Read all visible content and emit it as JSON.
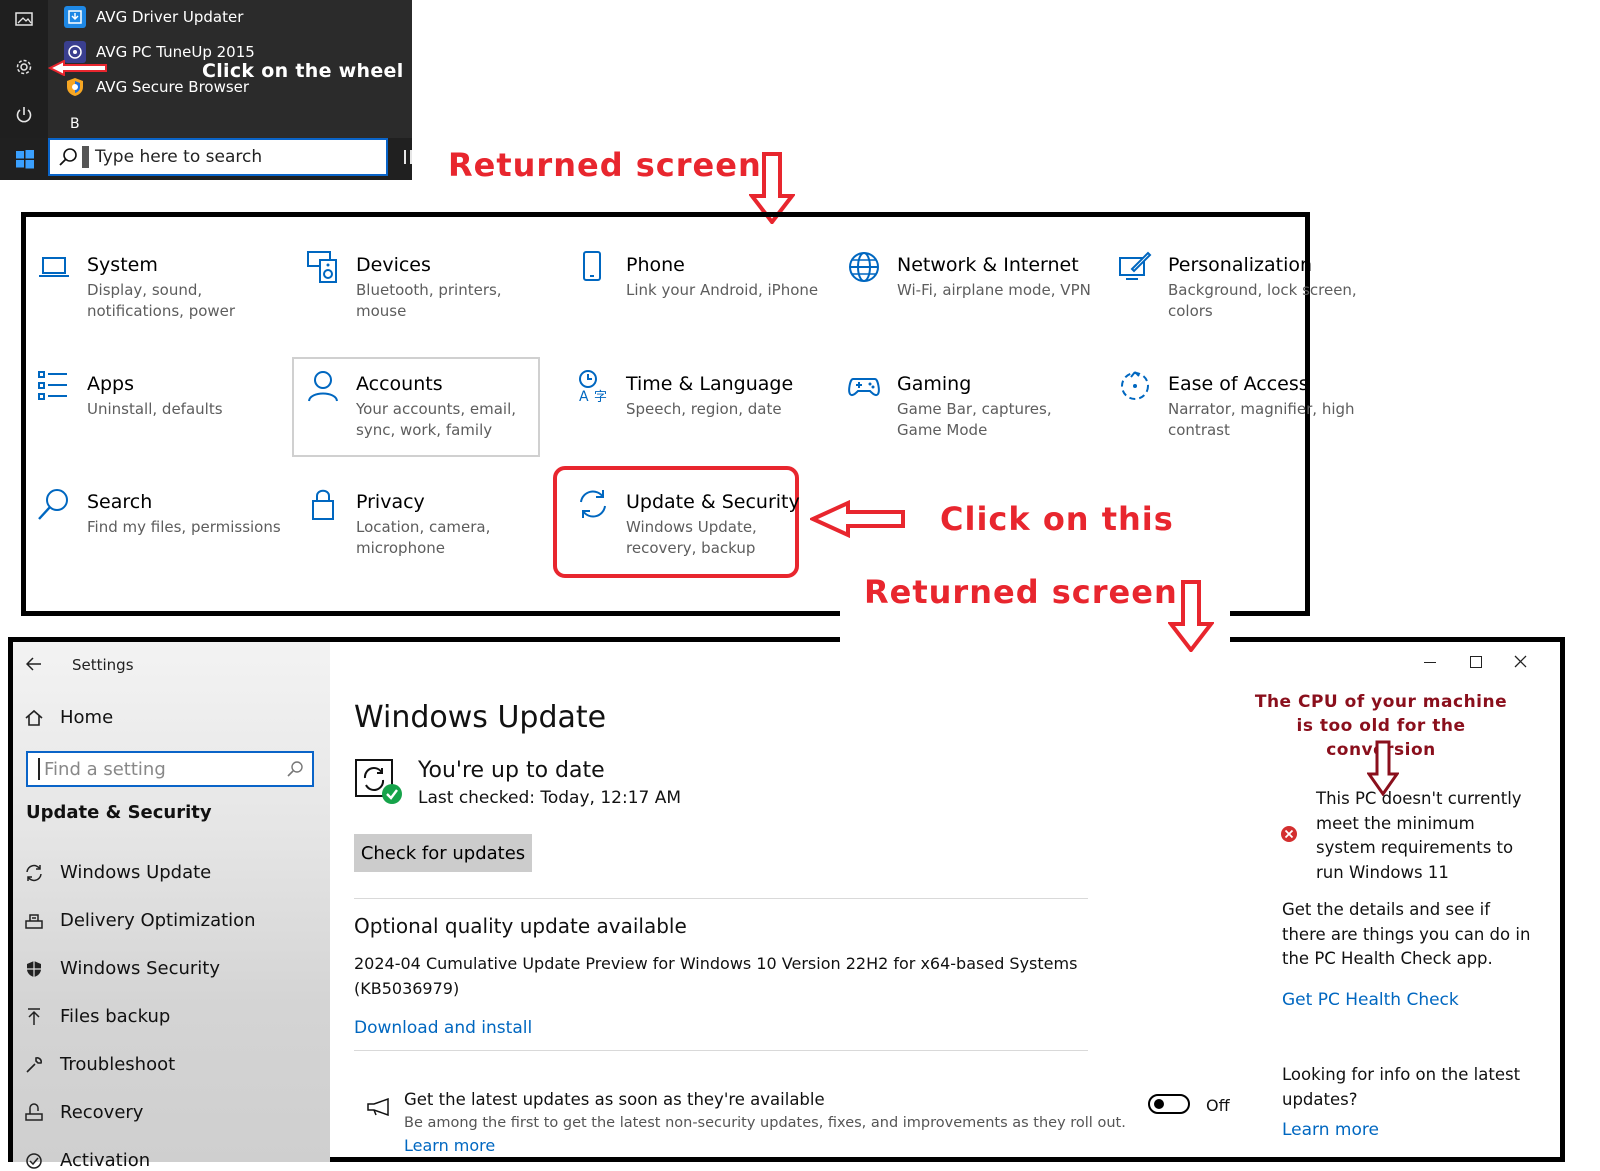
{
  "start_menu": {
    "apps": [
      {
        "label": "AVG Driver Updater"
      },
      {
        "label": "AVG PC TuneUp 2015"
      },
      {
        "label": "AVG Secure Browser"
      }
    ],
    "section_letter": "B",
    "search_placeholder": "Type here to search",
    "annotation": "Click on the wheel"
  },
  "annotations": {
    "returned_screen_1": "Returned screen",
    "click_on_this": "Click on this",
    "returned_screen_2": "Returned screen",
    "cpu_note": "The CPU of your machine is too old for the conversion",
    "accent_color": "#e8262e"
  },
  "settings_grid": {
    "tiles": [
      {
        "title": "System",
        "subtitle": "Display, sound, notifications, power"
      },
      {
        "title": "Devices",
        "subtitle": "Bluetooth, printers, mouse"
      },
      {
        "title": "Phone",
        "subtitle": "Link your Android, iPhone"
      },
      {
        "title": "Network & Internet",
        "subtitle": "Wi-Fi, airplane mode, VPN"
      },
      {
        "title": "Personalization",
        "subtitle": "Background, lock screen, colors"
      },
      {
        "title": "Apps",
        "subtitle": "Uninstall, defaults"
      },
      {
        "title": "Accounts",
        "subtitle": "Your accounts, email, sync, work, family"
      },
      {
        "title": "Time & Language",
        "subtitle": "Speech, region, date"
      },
      {
        "title": "Gaming",
        "subtitle": "Game Bar, captures, Game Mode"
      },
      {
        "title": "Ease of Access",
        "subtitle": "Narrator, magnifier, high contrast"
      },
      {
        "title": "Search",
        "subtitle": "Find my files, permissions"
      },
      {
        "title": "Privacy",
        "subtitle": "Location, camera, microphone"
      },
      {
        "title": "Update & Security",
        "subtitle": "Windows Update, recovery, backup"
      }
    ],
    "icon_color": "#0067c0"
  },
  "window": {
    "title": "Settings",
    "home_label": "Home",
    "find_placeholder": "Find a setting",
    "section_title": "Update & Security",
    "nav": [
      {
        "label": "Windows Update"
      },
      {
        "label": "Delivery Optimization"
      },
      {
        "label": "Windows Security"
      },
      {
        "label": "Files backup"
      },
      {
        "label": "Troubleshoot"
      },
      {
        "label": "Recovery"
      },
      {
        "label": "Activation"
      }
    ]
  },
  "update": {
    "page_title": "Windows Update",
    "status_title": "You're up to date",
    "last_checked": "Last checked: Today, 12:17 AM",
    "check_button": "Check for updates",
    "optional_title": "Optional quality update available",
    "optional_desc": "2024-04 Cumulative Update Preview for Windows 10 Version 22H2 for x64-based Systems (KB5036979)",
    "download_link": "Download and install",
    "latest_title": "Get the latest updates as soon as they're available",
    "latest_desc": "Be among the first to get the latest non-security updates, fixes, and improvements as they roll out.",
    "latest_link": "Learn more",
    "toggle_state": "Off"
  },
  "side_panel": {
    "win11_message": "This PC doesn't currently meet the minimum system requirements to run Windows 11",
    "details": "Get the details and see if there are things you can do in the PC Health Check app.",
    "health_link": "Get PC Health Check",
    "info": "Looking for info on the latest updates?",
    "info_link": "Learn more"
  }
}
